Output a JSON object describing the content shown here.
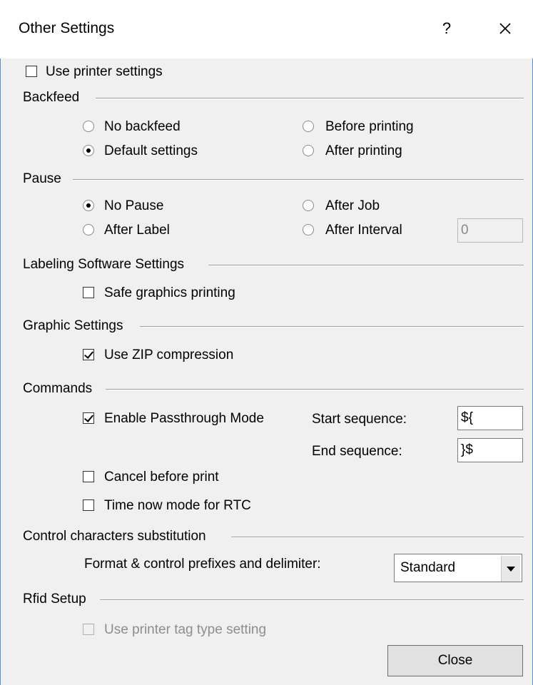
{
  "window": {
    "title": "Other Settings",
    "help_label": "?",
    "close_icon": "close-icon"
  },
  "use_printer_settings": {
    "label": "Use printer settings",
    "checked": false
  },
  "backfeed": {
    "title": "Backfeed",
    "options": [
      {
        "label": "No backfeed",
        "selected": false
      },
      {
        "label": "Default settings",
        "selected": true
      },
      {
        "label": "Before printing",
        "selected": false
      },
      {
        "label": "After printing",
        "selected": false
      }
    ]
  },
  "pause": {
    "title": "Pause",
    "options": [
      {
        "label": "No Pause",
        "selected": true
      },
      {
        "label": "After Label",
        "selected": false
      },
      {
        "label": "After Job",
        "selected": false
      },
      {
        "label": "After Interval",
        "selected": false
      }
    ],
    "interval_value": "0"
  },
  "labeling": {
    "title": "Labeling Software Settings",
    "safe_graphics": {
      "label": "Safe graphics printing",
      "checked": false
    }
  },
  "graphic": {
    "title": "Graphic Settings",
    "zip": {
      "label": "Use ZIP compression",
      "checked": true
    }
  },
  "commands": {
    "title": "Commands",
    "passthrough": {
      "label": "Enable Passthrough Mode",
      "checked": true
    },
    "start_label": "Start sequence:",
    "start_value": "${",
    "end_label": "End sequence:",
    "end_value": "}$",
    "cancel_before_print": {
      "label": "Cancel before print",
      "checked": false
    },
    "time_now_mode": {
      "label": "Time now mode for RTC",
      "checked": false
    }
  },
  "control_chars": {
    "title": "Control characters substitution",
    "format_label": "Format & control prefixes and delimiter:",
    "format_value": "Standard"
  },
  "rfid": {
    "title": "Rfid Setup",
    "tag_type": {
      "label": "Use printer tag type setting",
      "checked": false,
      "enabled": false
    }
  },
  "footer": {
    "close_label": "Close"
  }
}
